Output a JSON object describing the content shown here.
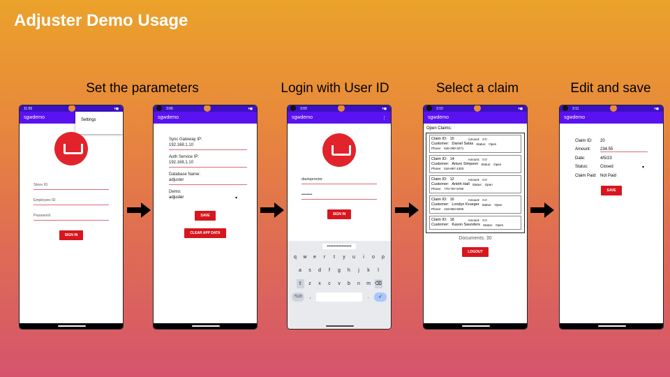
{
  "slide": {
    "title": "Adjuster Demo Usage",
    "steps": [
      "Set the parameters",
      "Login with User ID",
      "Select a claim",
      "Edit and save"
    ]
  },
  "app_name": "sgwdemo",
  "phone1": {
    "time": "11:55",
    "menu_item": "Settings",
    "fields": [
      "Store ID",
      "Employee ID",
      "Password"
    ],
    "button": "SIGN IN"
  },
  "phone2": {
    "time": "3:06",
    "labels": {
      "sync": "Sync Gateway IP:",
      "auth": "Auth Service IP:",
      "db": "Database Name:",
      "demo": "Demo:"
    },
    "values": {
      "sync": "192.168.1.10",
      "auth": "192.168.1.10",
      "db": "adjuster",
      "demo": "adjuster"
    },
    "save": "SAVE",
    "clear": "CLEAR APP DATA"
  },
  "phone3": {
    "time": "3:09",
    "user": "davisproctor",
    "password": "••••••••",
    "button": "SIGN IN",
    "suggestion": "••••••••••••••••••••",
    "rows": [
      [
        "q",
        "w",
        "e",
        "r",
        "t",
        "y",
        "u",
        "i",
        "o",
        "p"
      ],
      [
        "a",
        "s",
        "d",
        "f",
        "g",
        "h",
        "j",
        "k",
        "l"
      ],
      [
        "⇧",
        "z",
        "x",
        "c",
        "v",
        "b",
        "n",
        "m",
        "⌫"
      ]
    ],
    "sym": "?123",
    "comma": ",",
    "period": "."
  },
  "phone4": {
    "time": "3:10",
    "header": "Open Claims:",
    "labels": {
      "claim": "Claim ID:",
      "amount": "Amount:",
      "customer": "Customer:",
      "status": "Status:",
      "phone": "Phone:"
    },
    "claims": [
      {
        "id": "15",
        "amount": "0.0",
        "customer": "Daniel Salas",
        "status": "Open",
        "phone": "646-290-3271"
      },
      {
        "id": "14",
        "amount": "0.0",
        "customer": "Arturo Simpson",
        "status": "Open",
        "phone": "516-867-1303"
      },
      {
        "id": "12",
        "amount": "0.0",
        "customer": "Arleth Hall",
        "status": "Open",
        "phone": "770-797-9780"
      },
      {
        "id": "16",
        "amount": "0.0",
        "customer": "Londyn Krueger",
        "status": "Open",
        "phone": "418-963-9205"
      },
      {
        "id": "18",
        "amount": "0.0",
        "customer": "Kason Saunders",
        "status": "Open",
        "phone": ""
      }
    ],
    "documents": "Documents: 30",
    "logout": "LOGOUT"
  },
  "phone5": {
    "time": "3:11",
    "rows": [
      {
        "k": "Claim ID:",
        "v": "20"
      },
      {
        "k": "Amount:",
        "v": "234.55"
      },
      {
        "k": "Date:",
        "v": "4/5/23"
      },
      {
        "k": "Status:",
        "v": "Closed"
      },
      {
        "k": "Claim Paid:",
        "v": "Not Paid"
      }
    ],
    "save": "SAVE"
  }
}
